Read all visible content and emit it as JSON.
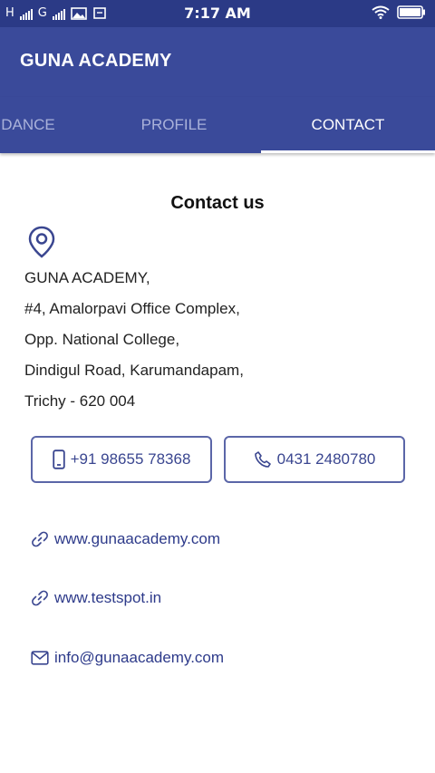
{
  "status_bar": {
    "network_1": "H",
    "network_2": "G",
    "time": "7:17 AM"
  },
  "app": {
    "title": "GUNA ACADEMY"
  },
  "tabs": [
    {
      "label": "DANCE",
      "active": false
    },
    {
      "label": "PROFILE",
      "active": false
    },
    {
      "label": "CONTACT",
      "active": true
    }
  ],
  "contact": {
    "heading": "Contact us",
    "address_lines": [
      "GUNA ACADEMY,",
      "#4, Amalorpavi Office Complex,",
      "Opp. National College,",
      "Dindigul Road, Karumandapam,",
      "Trichy - 620 004"
    ],
    "mobile": "+91 98655 78368",
    "landline": "0431 2480780",
    "website_1": "www.gunaacademy.com",
    "website_2": "www.testspot.in",
    "email": "info@gunaacademy.com"
  },
  "colors": {
    "primary": "#3a4a9a",
    "status_bar": "#2b3a86",
    "accent_text": "#2d3a8a"
  }
}
